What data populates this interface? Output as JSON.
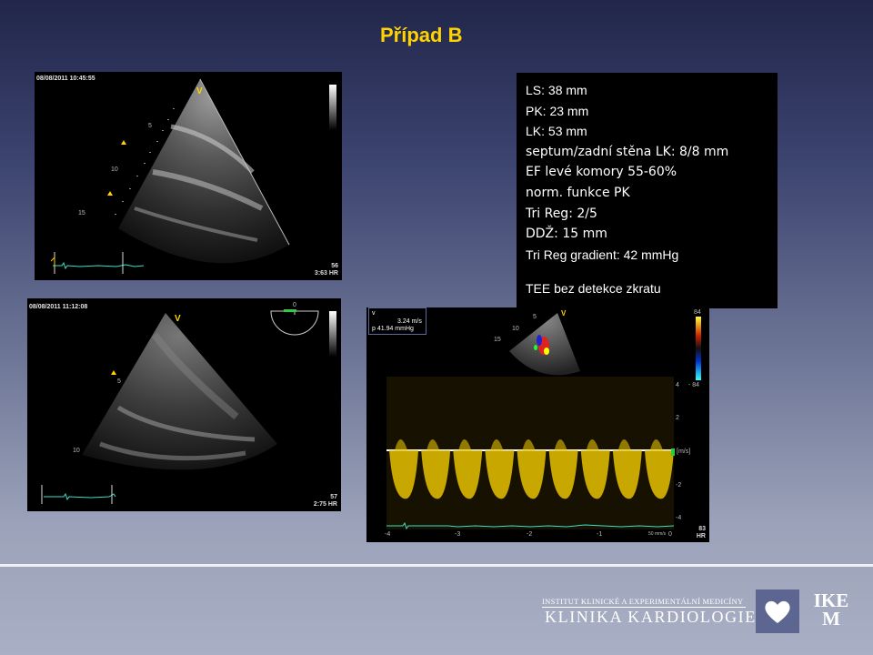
{
  "slide": {
    "title": "Případ B"
  },
  "echo_top": {
    "timestamp": "08/08/2011 10:45:55",
    "marker": "V",
    "depth_ticks": [
      "5",
      "10",
      "15"
    ],
    "hr_value": "56",
    "time_and_hr": "3:63  HR"
  },
  "echo_bottom": {
    "timestamp": "08/08/2011 11:12:08",
    "marker": "V",
    "depth_ticks": [
      "5",
      "10"
    ],
    "inset_label": "0",
    "hr_value": "57",
    "time_and_hr": "2:75  HR"
  },
  "doppler": {
    "info": {
      "velocity": "3.24 m/s",
      "pressure": "p 41.94 mmHg",
      "v_label": "v"
    },
    "color_scale_top": "84",
    "color_scale_bottom": "- 84",
    "inset_marker": "V",
    "inset_ticks": [
      "5",
      "10",
      "15"
    ],
    "velocity_axis": [
      "4",
      "2",
      "-2",
      "-4"
    ],
    "unit": "[m/s]",
    "time_axis": [
      "-4",
      "-3",
      "-2",
      "-1",
      "0"
    ],
    "sweep": "50 mm/s",
    "hr_value": "83",
    "hr_label": "HR",
    "chart_data": {
      "type": "line",
      "title": "",
      "xlabel": "",
      "ylabel": "[m/s]",
      "x": [
        -4.2,
        -3.7,
        -3.2,
        -2.7,
        -2.2,
        -1.7,
        -1.2,
        -0.7,
        -0.2
      ],
      "series": [
        {
          "values": [
            -3.2,
            -3.2,
            -3.2,
            -3.2,
            -3.2,
            -3.2,
            -3.2,
            -3.2,
            -3.2
          ]
        }
      ],
      "xlim": [
        -4.5,
        0
      ],
      "ylim": [
        -4.5,
        4.5
      ]
    }
  },
  "findings": {
    "lines": [
      "LS: 38 mm",
      "PK: 23 mm",
      "LK: 53 mm",
      "septum/zadní stěna LK: 8/8 mm",
      "EF levé komory 55-60%",
      "norm. funkce PK",
      "Tri Reg: 2/5",
      "DDŽ: 15 mm",
      "Tri Reg gradient: 42 mmHg"
    ],
    "note": "TEE bez detekce zkratu"
  },
  "logo": {
    "institute": "INSTITUT KLINICKÉ A EXPERIMENTÁLNÍ MEDICÍNY",
    "department": "KLINIKA KARDIOLOGIE",
    "brand_line1": "IKE",
    "brand_line2": "M"
  },
  "colors": {
    "title_yellow": "#ffd200",
    "doppler_yellow": "#e6c200",
    "ecg_green": "#3ce0c8",
    "logo_box": "#5d6690"
  }
}
